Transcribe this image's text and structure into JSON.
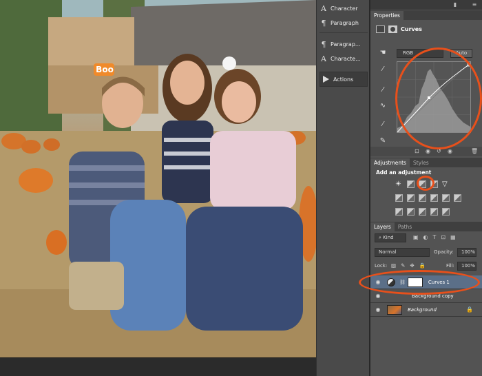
{
  "dock": {
    "items": [
      {
        "label": "Character",
        "icon": "A"
      },
      {
        "label": "Paragraph",
        "icon": "¶"
      },
      {
        "label": "Paragrap...",
        "icon": "¶"
      },
      {
        "label": "Characte...",
        "icon": "A"
      }
    ],
    "actions_label": "Actions"
  },
  "properties": {
    "tab_label": "Properties",
    "panel_title": "Curves",
    "channel_value": "RGB",
    "auto_label": "Auto"
  },
  "adjustments": {
    "tabs": [
      "Adjustments",
      "Styles"
    ],
    "heading": "Add an adjustment"
  },
  "layers": {
    "tabs": [
      "Layers",
      "Paths"
    ],
    "filter_value": "Kind",
    "blend_mode": "Normal",
    "opacity_label": "Opacity:",
    "opacity_value": "100%",
    "lock_label": "Lock:",
    "fill_label": "Fill:",
    "fill_value": "100%",
    "items": [
      {
        "name": "Curves 1",
        "selected": true
      },
      {
        "name": "Background copy",
        "selected": false
      },
      {
        "name": "Background",
        "selected": false
      }
    ]
  },
  "photo_sign_text": "Boo",
  "colors": {
    "annotation": "#e8501b",
    "selected_layer": "#5b6f88",
    "panel_bg": "#535353"
  }
}
